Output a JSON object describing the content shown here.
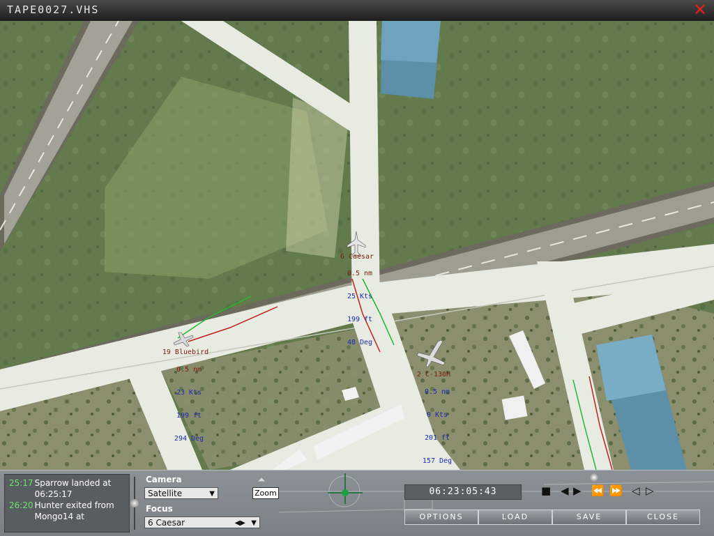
{
  "window": {
    "title": "TAPE0027.VHS",
    "close_icon": "close-icon"
  },
  "aircraft": [
    {
      "name": "6 Caesar",
      "range": "0.5 nm",
      "speed": "25 Kts",
      "altitude": "199 ft",
      "heading": "48 Deg"
    },
    {
      "name": "19 Bluebird",
      "range": "0.5 nm",
      "speed": "23 Kts",
      "altitude": "199 ft",
      "heading": "294 Deg"
    },
    {
      "name": "2 C-130H",
      "range": "0.5 nm",
      "speed": "0 Kts",
      "altitude": "201 ft",
      "heading": "157 Deg"
    }
  ],
  "log": [
    {
      "time": "25:17",
      "text": "Sparrow landed at 06:25:17"
    },
    {
      "time": "26:20",
      "text": "Hunter exited from Mongo14 at"
    }
  ],
  "camera": {
    "label": "Camera",
    "value": "Satellite"
  },
  "focus": {
    "label": "Focus",
    "value": "6 Caesar"
  },
  "zoom": {
    "label": "Zoom"
  },
  "timecode": "06:23:05:43",
  "playback": [
    "stop-icon",
    "step-back-icon",
    "step-forward-icon",
    "rewind-icon",
    "fast-forward-icon",
    "prev-icon",
    "next-icon"
  ],
  "buttons": {
    "options": "OPTIONS",
    "load": "LOAD",
    "save": "SAVE",
    "close": "CLOSE"
  },
  "colors": {
    "log_time": "#6ee36e",
    "close": "#e0201c",
    "label_name": "#7a1c10",
    "label_stat": "#1a2ab0"
  }
}
